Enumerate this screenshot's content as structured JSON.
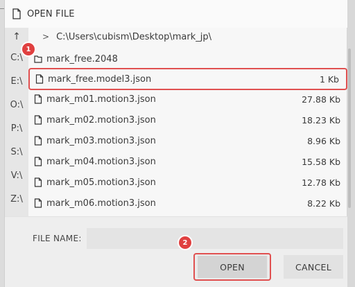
{
  "dialog": {
    "title": "OPEN FILE",
    "path": "C:\\Users\\cubism\\Desktop\\mark_jp\\"
  },
  "sidebar": {
    "up_label": "↑",
    "drives": [
      "C:\\",
      "E:\\",
      "O:\\",
      "P:\\",
      "S:\\",
      "V:\\",
      "Z:\\"
    ]
  },
  "files": [
    {
      "name": "mark_free.2048",
      "size": "",
      "kind": "folder"
    },
    {
      "name": "mark_free.model3.json",
      "size": "1 Kb",
      "kind": "file",
      "selected": true
    },
    {
      "name": "mark_m01.motion3.json",
      "size": "27.88 Kb",
      "kind": "file"
    },
    {
      "name": "mark_m02.motion3.json",
      "size": "18.23 Kb",
      "kind": "file"
    },
    {
      "name": "mark_m03.motion3.json",
      "size": "8.96 Kb",
      "kind": "file"
    },
    {
      "name": "mark_m04.motion3.json",
      "size": "15.58 Kb",
      "kind": "file"
    },
    {
      "name": "mark_m05.motion3.json",
      "size": "12.78 Kb",
      "kind": "file"
    },
    {
      "name": "mark_m06.motion3.json",
      "size": "8.22 Kb",
      "kind": "file"
    }
  ],
  "footer": {
    "file_name_label": "FILE NAME:",
    "file_name_value": "",
    "open_label": "OPEN",
    "cancel_label": "CANCEL"
  },
  "annotations": {
    "badge_1": "1",
    "badge_2": "2",
    "highlight_color": "#e05050"
  }
}
